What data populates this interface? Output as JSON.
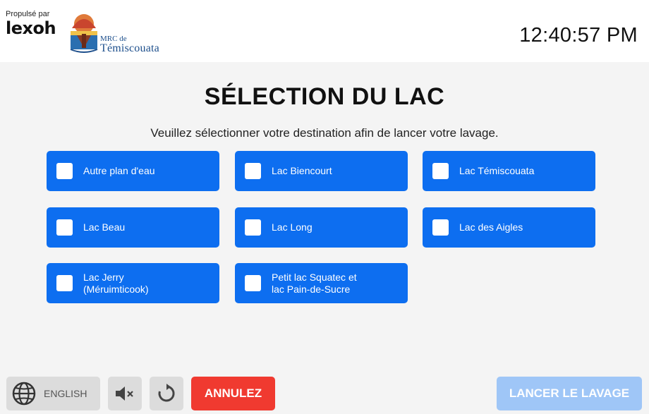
{
  "header": {
    "powered_by": "Propulsé par",
    "brand": "lexoh",
    "logo_line1": "MRC de",
    "logo_line2": "Témiscouata",
    "clock": "12:40:57 PM"
  },
  "main": {
    "title": "SÉLECTION DU LAC",
    "subtitle": "Veuillez sélectionner votre destination afin de lancer votre lavage.",
    "lakes": [
      {
        "label": "Autre plan d'eau",
        "checked": false
      },
      {
        "label": "Lac Biencourt",
        "checked": false
      },
      {
        "label": "Lac Témiscouata",
        "checked": false
      },
      {
        "label": "Lac Beau",
        "checked": false
      },
      {
        "label": "Lac Long",
        "checked": false
      },
      {
        "label": "Lac des Aigles",
        "checked": false
      },
      {
        "label": "Lac Jerry\n(Méruimticook)",
        "checked": false
      },
      {
        "label": "Petit lac Squatec et\nlac Pain-de-Sucre",
        "checked": false
      }
    ]
  },
  "footer": {
    "language_label": "ENGLISH",
    "cancel_label": "ANNULEZ",
    "launch_label": "LANCER LE LAVAGE",
    "launch_enabled": false
  },
  "colors": {
    "primary": "#0d6ef0",
    "cancel": "#f03a30",
    "disabled": "#9fc6f7",
    "logo_blue": "#1d4f8c"
  },
  "icons": {
    "language": "globe-icon",
    "mute": "speaker-mute-icon",
    "reset": "refresh-icon"
  }
}
